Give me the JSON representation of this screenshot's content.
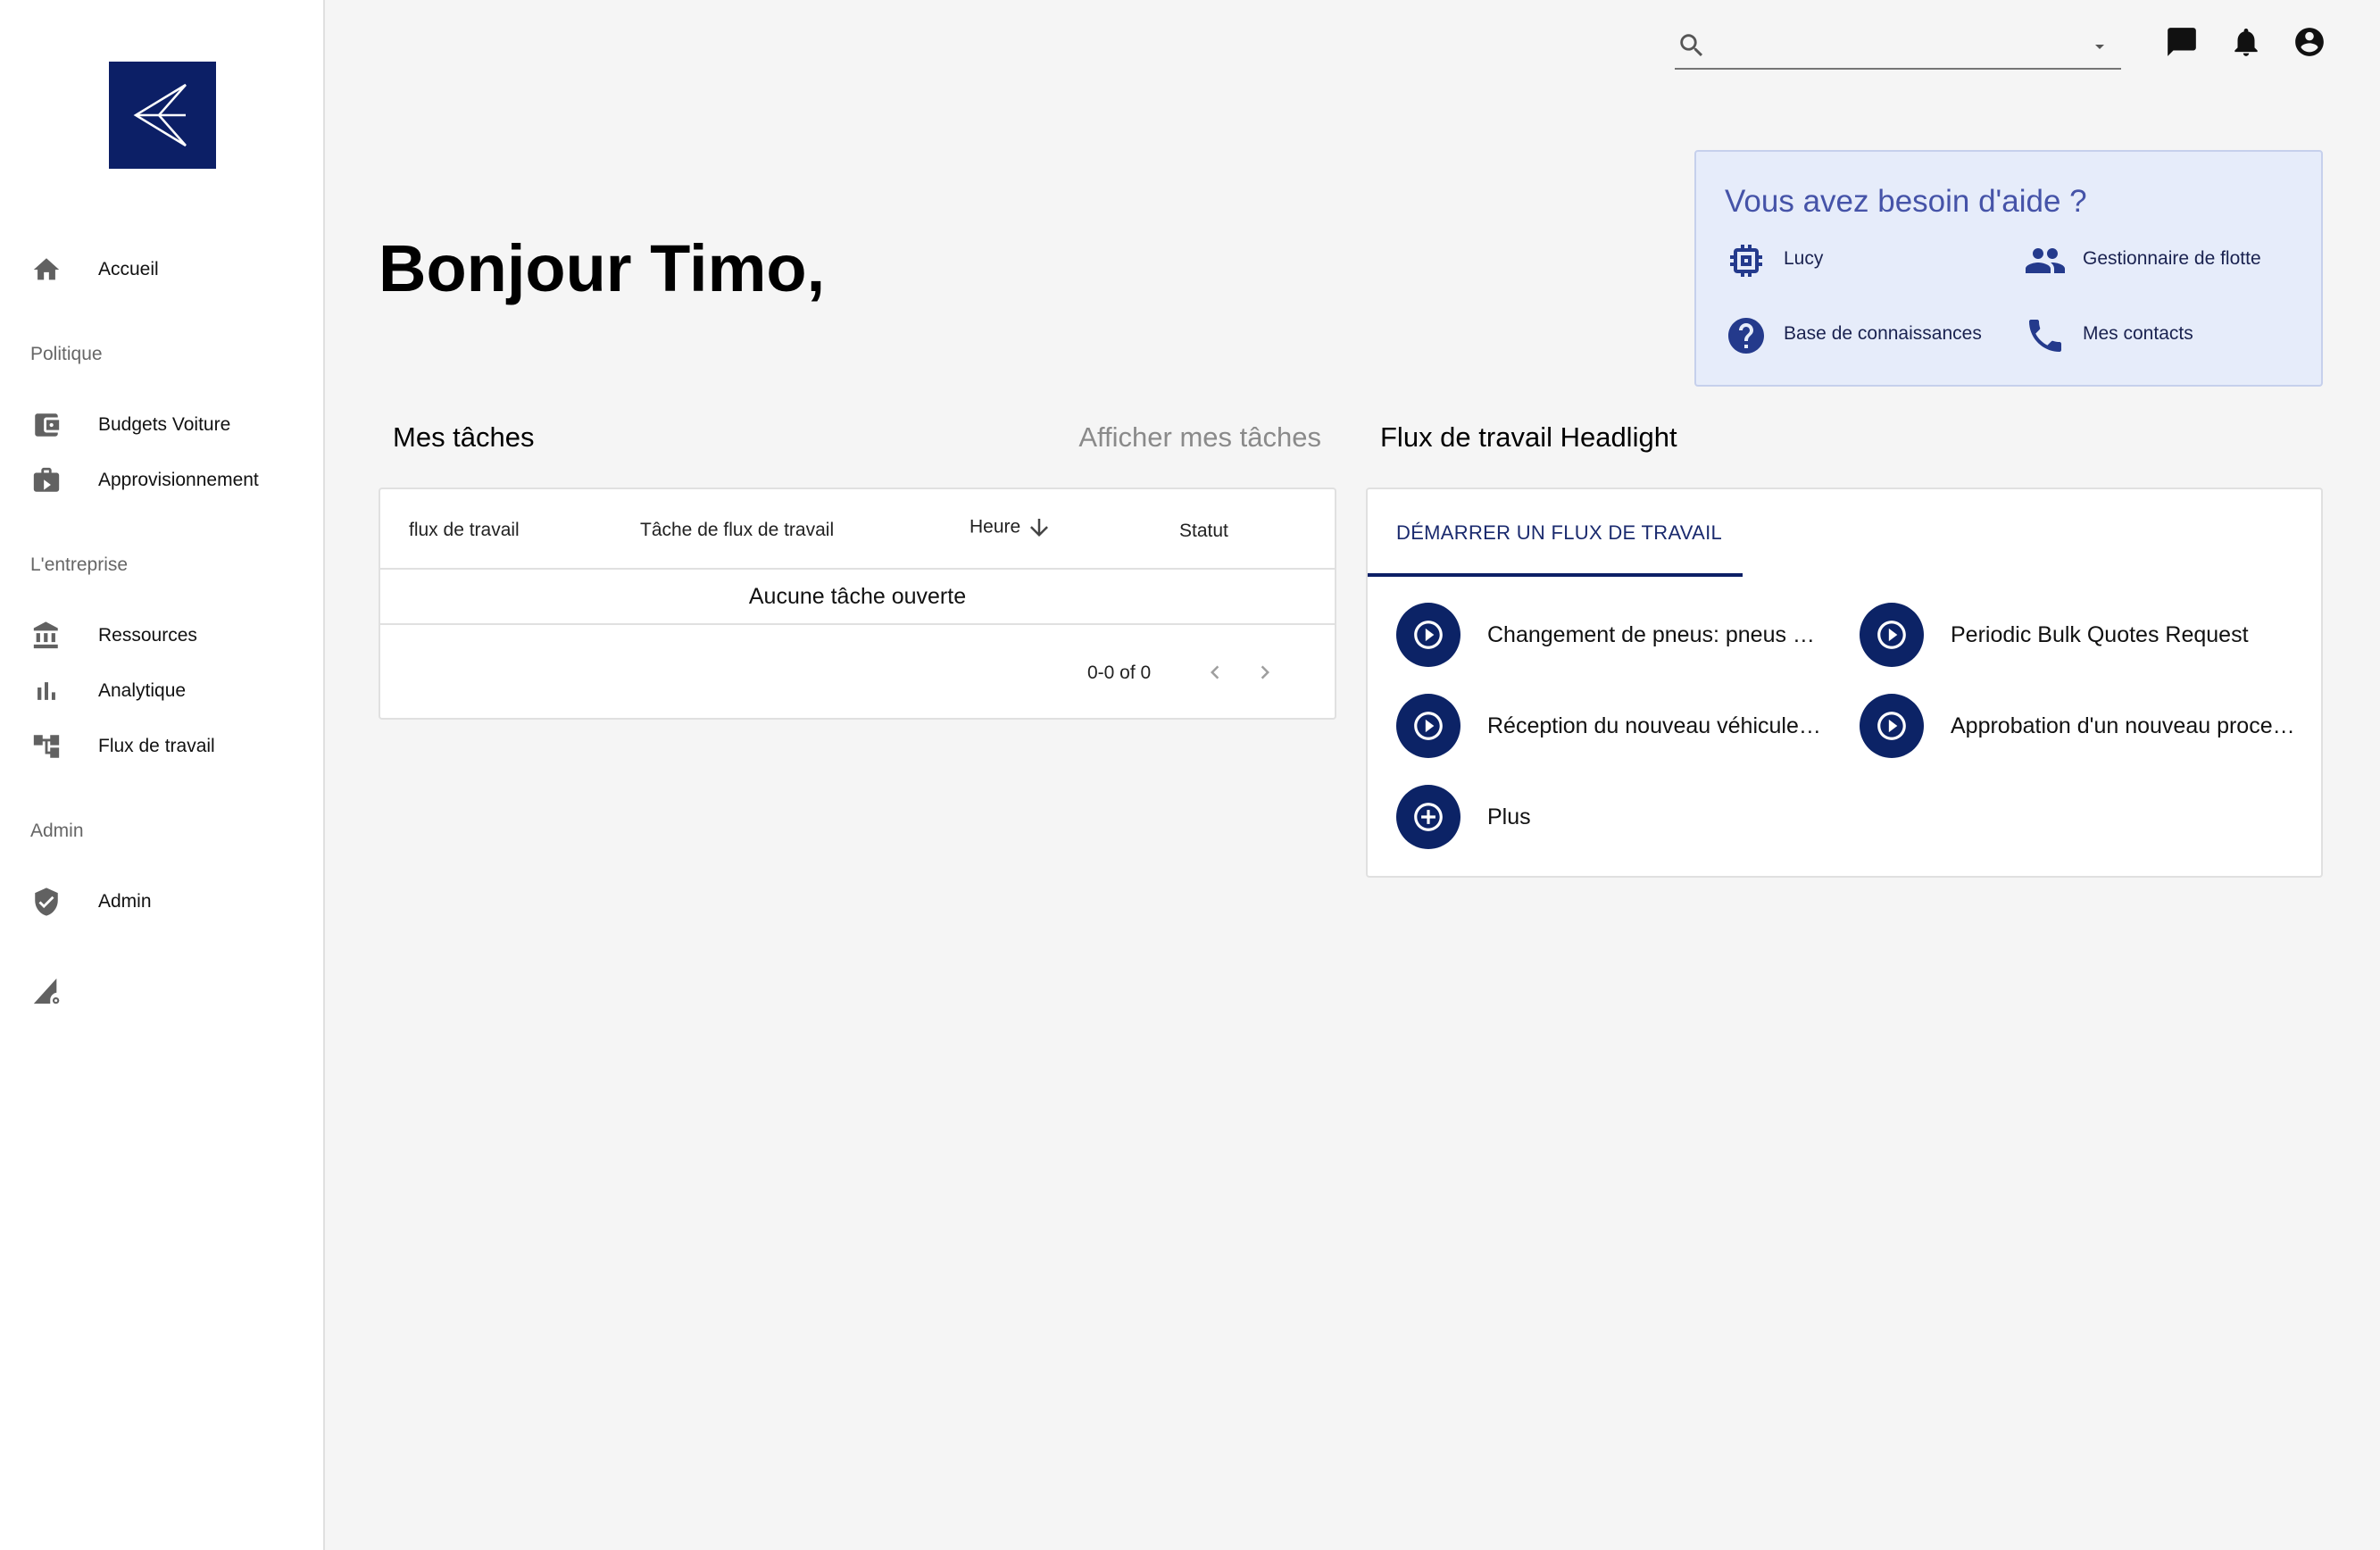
{
  "sidebar": {
    "logo_icon": "brand-logo",
    "items": [
      {
        "label": "Accueil",
        "icon": "home-icon"
      },
      {
        "label": "Budgets Voiture",
        "icon": "wallet-icon"
      },
      {
        "label": "Approvisionnement",
        "icon": "procurement-icon"
      },
      {
        "label": "Ressources",
        "icon": "bank-icon"
      },
      {
        "label": "Analytique",
        "icon": "bar-chart-icon"
      },
      {
        "label": "Flux de travail",
        "icon": "workflow-icon"
      },
      {
        "label": "Admin",
        "icon": "shield-check-icon"
      }
    ],
    "sections": [
      "Politique",
      "L'entreprise",
      "Admin"
    ],
    "settings_icon": "signal-settings-icon"
  },
  "topbar": {
    "search_value": "",
    "icons": [
      "chat-icon",
      "bell-icon",
      "account-icon"
    ]
  },
  "greeting": "Bonjour Timo,",
  "help": {
    "title": "Vous avez besoin d'aide ?",
    "items": [
      {
        "label": "Lucy",
        "icon": "chip-icon"
      },
      {
        "label": "Gestionnaire de flotte",
        "icon": "people-icon"
      },
      {
        "label": "Base de connaissances",
        "icon": "help-circle-icon"
      },
      {
        "label": "Mes contacts",
        "icon": "phone-icon"
      }
    ]
  },
  "tasks": {
    "title": "Mes tâches",
    "link": "Afficher mes tâches",
    "columns": [
      "flux de travail",
      "Tâche de flux de travail",
      "Heure",
      "Statut"
    ],
    "empty": "Aucune tâche ouverte",
    "pagination": "0-0 of 0"
  },
  "flows": {
    "title": "Flux de travail Headlight",
    "tab": "DÉMARRER UN FLUX DE TRAVAIL",
    "items": [
      {
        "label": "Changement de pneus: pneus hiver/été",
        "icon": "play-circle-icon"
      },
      {
        "label": "Periodic Bulk Quotes Request",
        "icon": "play-circle-icon"
      },
      {
        "label": "Réception du nouveau véhicule de société",
        "icon": "play-circle-icon"
      },
      {
        "label": "Approbation d'un nouveau processus d'achat",
        "icon": "play-circle-icon"
      },
      {
        "label": "Plus",
        "icon": "plus-circle-icon"
      }
    ]
  },
  "colors": {
    "brand_navy": "#0c1f66",
    "help_bg": "#e6ecfa",
    "help_accent": "#4553a8"
  }
}
